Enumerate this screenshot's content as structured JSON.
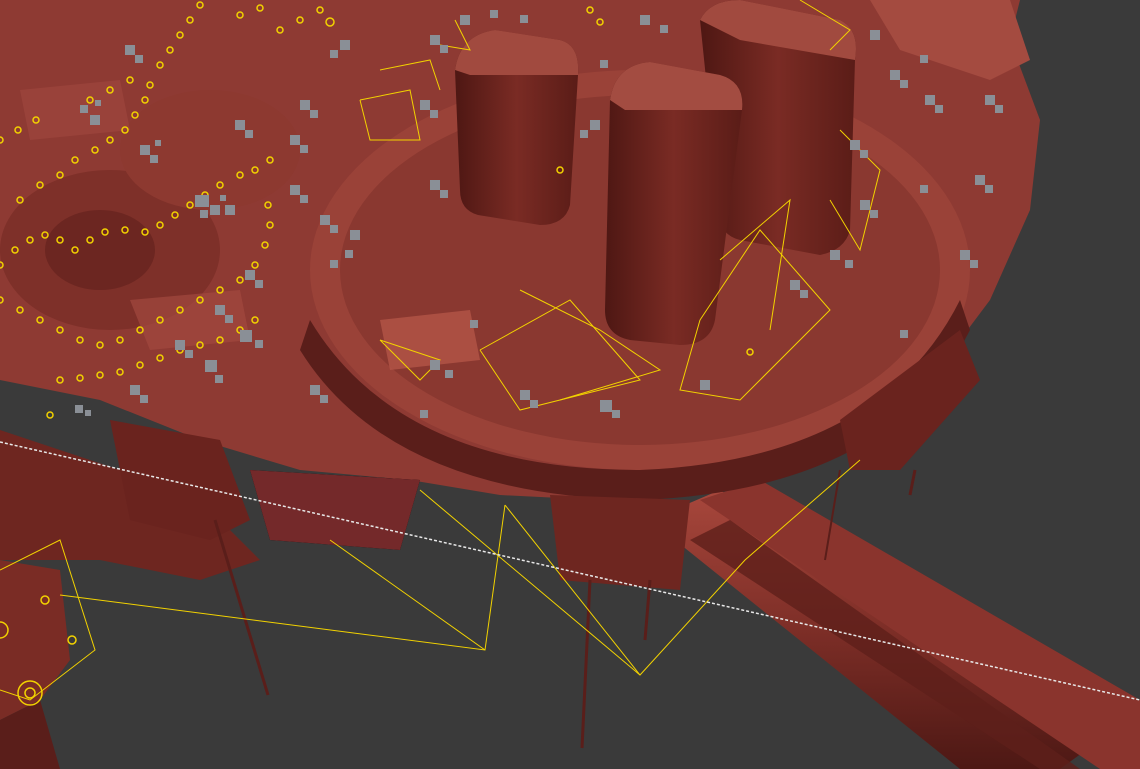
{
  "viewport": {
    "background": "#3a3a3a",
    "mesh_color": "#8e3a33",
    "mesh_shadow": "#5a1e1a",
    "mesh_highlight": "#b35547",
    "helper_color": "#f2d200",
    "point_color": "#8a8f96",
    "guide_line_color": "#e8e8e8"
  }
}
